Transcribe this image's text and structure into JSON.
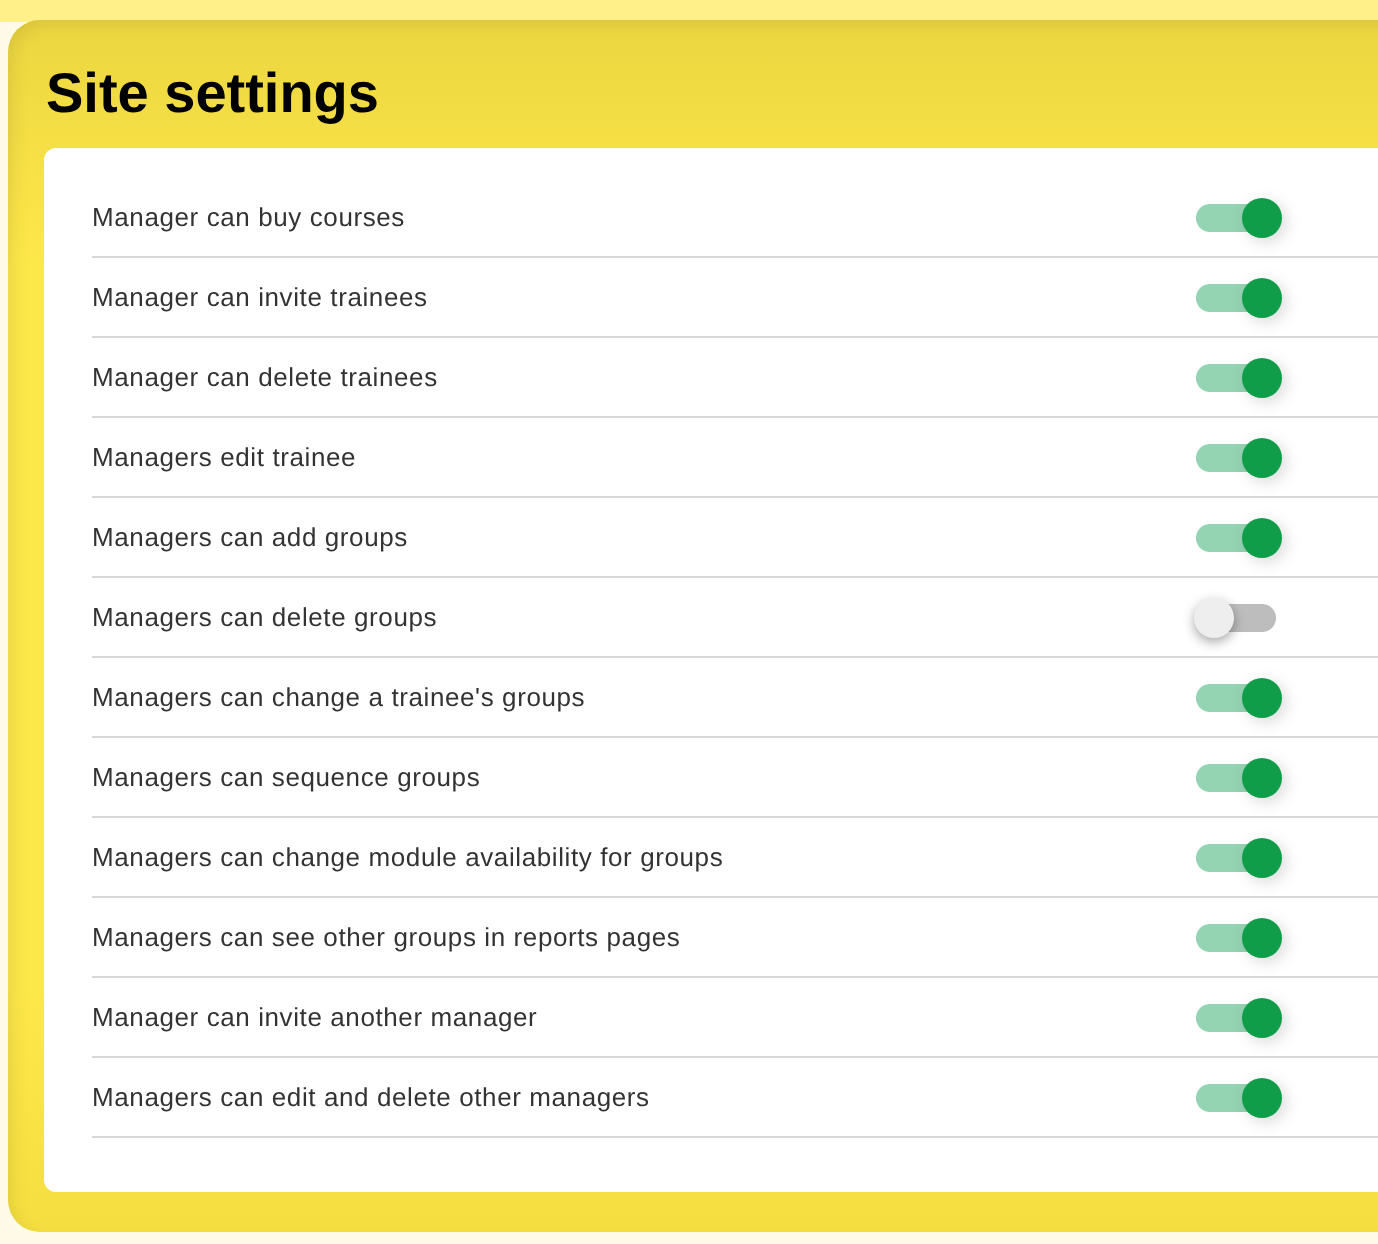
{
  "title": "Site settings",
  "settings": [
    {
      "label": "Manager can buy courses",
      "on": true
    },
    {
      "label": "Manager can invite trainees",
      "on": true
    },
    {
      "label": "Manager can delete trainees",
      "on": true
    },
    {
      "label": "Managers edit trainee",
      "on": true
    },
    {
      "label": "Managers can add groups",
      "on": true
    },
    {
      "label": "Managers can delete groups",
      "on": false
    },
    {
      "label": "Managers can change a trainee's groups",
      "on": true
    },
    {
      "label": "Managers can sequence groups",
      "on": true
    },
    {
      "label": "Managers can change module availability for groups",
      "on": true
    },
    {
      "label": "Managers can see other groups in reports pages",
      "on": true
    },
    {
      "label": "Manager can invite another manager",
      "on": true
    },
    {
      "label": "Managers can edit and delete other managers",
      "on": true
    }
  ]
}
